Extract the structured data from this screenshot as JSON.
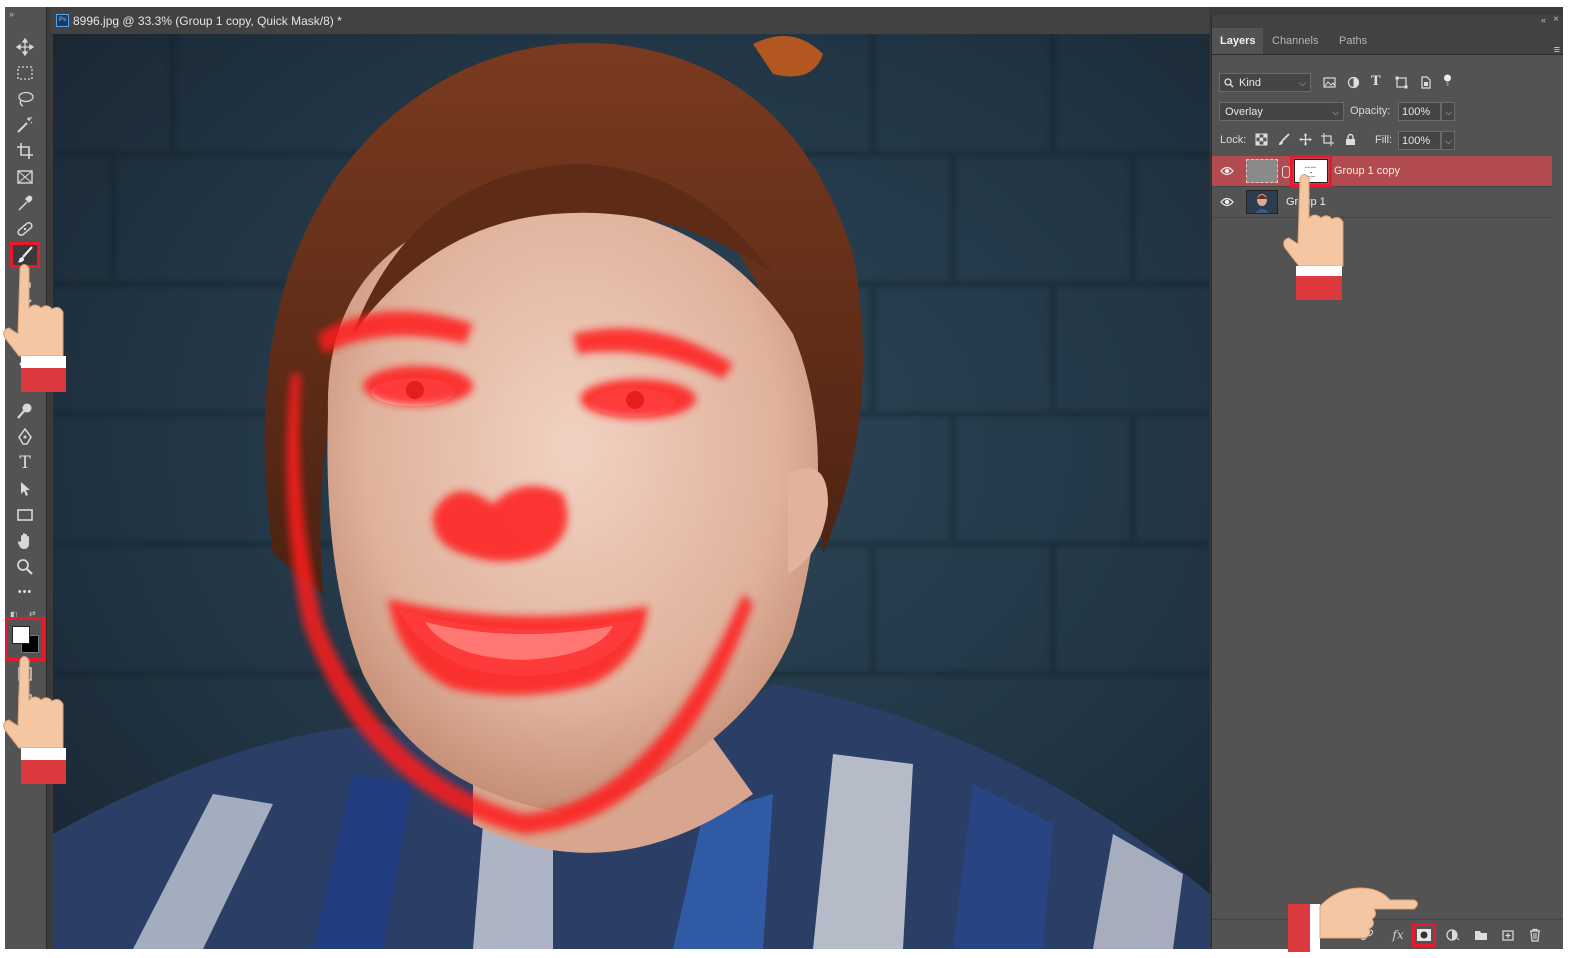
{
  "document": {
    "title": "8996.jpg @ 33.3% (Group 1 copy, Quick Mask/8) *",
    "app_badge": "Ps"
  },
  "toolbar": {
    "tools": [
      {
        "name": "move-tool",
        "icon": "move-icon"
      },
      {
        "name": "marquee-tool",
        "icon": "rect-marquee-icon"
      },
      {
        "name": "lasso-tool",
        "icon": "lasso-icon"
      },
      {
        "name": "magic-wand-tool",
        "icon": "magic-wand-icon"
      },
      {
        "name": "crop-tool",
        "icon": "crop-icon"
      },
      {
        "name": "frame-tool",
        "icon": "frame-icon"
      },
      {
        "name": "eyedropper-tool",
        "icon": "eyedropper-icon"
      },
      {
        "name": "healing-brush-tool",
        "icon": "bandage-icon"
      },
      {
        "name": "brush-tool",
        "icon": "brush-icon",
        "active": true
      },
      {
        "name": "dodge-tool",
        "icon": "dodge-icon"
      },
      {
        "name": "pen-tool",
        "icon": "pen-icon"
      },
      {
        "name": "type-tool",
        "icon": "type-icon"
      },
      {
        "name": "path-selection-tool",
        "icon": "arrow-icon"
      },
      {
        "name": "rectangle-tool",
        "icon": "rectangle-icon"
      },
      {
        "name": "hand-tool",
        "icon": "hand-icon"
      },
      {
        "name": "zoom-tool",
        "icon": "zoom-icon"
      },
      {
        "name": "more-tools",
        "icon": "ellipsis-icon"
      }
    ],
    "type_glyph": "T",
    "more_glyph": "•••",
    "foreground_color": "#ffffff",
    "background_color": "#000000"
  },
  "panel": {
    "tabs": [
      "Layers",
      "Channels",
      "Paths"
    ],
    "active_tab": "Layers",
    "filter": {
      "value": "Kind"
    },
    "blend_mode": {
      "value": "Overlay"
    },
    "opacity": {
      "label": "Opacity:",
      "value": "100%"
    },
    "lock": {
      "label": "Lock:"
    },
    "fill": {
      "label": "Fill:",
      "value": "100%"
    },
    "collapse_glyph": "«",
    "close_glyph": "×",
    "menu_glyph": "≡",
    "type_glyph": "T",
    "layers": [
      {
        "name": "Group 1 copy",
        "selected": true,
        "visible": true,
        "has_mask": true
      },
      {
        "name": "Group 1",
        "selected": false,
        "visible": true,
        "has_mask": false
      }
    ],
    "bottom": {
      "fx_label": "fx"
    }
  },
  "colors": {
    "highlight": "#e8192c",
    "selected_layer": "#b24b4f",
    "quick_mask_overlay": "#ff1e1e",
    "panel_bg": "#535353"
  }
}
